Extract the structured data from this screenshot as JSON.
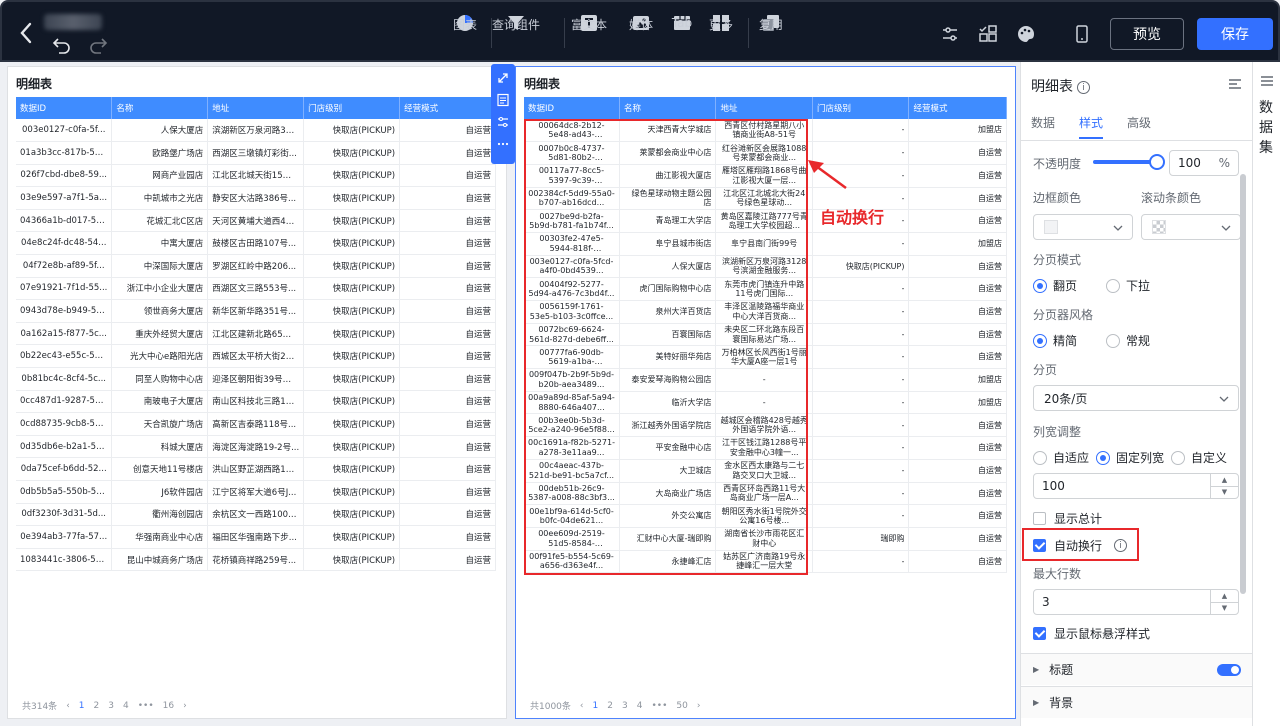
{
  "topbar": {
    "tools": [
      {
        "label": "图表",
        "icon": "pie-chart-icon"
      },
      {
        "label": "查询组件",
        "icon": "filter-icon"
      },
      {
        "label": "富文本",
        "icon": "rich-text-icon"
      },
      {
        "label": "媒体",
        "icon": "image-icon"
      },
      {
        "label": "Tab",
        "icon": "tab-icon"
      },
      {
        "label": "更多",
        "icon": "grid-icon"
      },
      {
        "label": "复用",
        "icon": "copy-icon"
      }
    ],
    "preview_label": "预览",
    "save_label": "保存"
  },
  "left_table": {
    "title": "明细表",
    "columns": [
      "数据ID",
      "名称",
      "地址",
      "门店级别",
      "经营模式"
    ],
    "rows": [
      [
        "003e0127-c0fa-5f...",
        "人保大厦店",
        "滨湖新区万泉河路31...",
        "快取店(PICKUP)",
        "自运营"
      ],
      [
        "01a3b3cc-817b-51...",
        "欧路堡广场店",
        "西湖区三墩镇灯彩街...",
        "快取店(PICKUP)",
        "自运营"
      ],
      [
        "026f7cbd-dbe8-59...",
        "网商产业园店",
        "江北区北城天街15号...",
        "快取店(PICKUP)",
        "自运营"
      ],
      [
        "03e9e597-a7f1-5a...",
        "中凯城市之光店",
        "静安区大沽路386号...",
        "快取店(PICKUP)",
        "自运营"
      ],
      [
        "04366a1b-d017-52...",
        "花城汇北C区店",
        "天河区黄埔大道西47...",
        "快取店(PICKUP)",
        "自运营"
      ],
      [
        "04e8c24f-dc48-54...",
        "中寓大厦店",
        "鼓楼区古田路107号...",
        "快取店(PICKUP)",
        "自运营"
      ],
      [
        "04f72e8b-af89-5f...",
        "中深国际大厦店",
        "罗湖区红岭中路206...",
        "快取店(PICKUP)",
        "自运营"
      ],
      [
        "07e91921-7f1d-55...",
        "浙江中小企业大厦店",
        "西湖区文三路553号...",
        "快取店(PICKUP)",
        "自运营"
      ],
      [
        "0943d78e-b949-5b...",
        "领世商务大厦店",
        "新华区新华路351号...",
        "快取店(PICKUP)",
        "自运营"
      ],
      [
        "0a162a15-f877-5c...",
        "重庆外经贸大厦店",
        "江北区建新北路65号...",
        "快取店(PICKUP)",
        "自运营"
      ],
      [
        "0b22ec43-e55c-5a...",
        "光大中心e路阳光店",
        "西城区太平桥大街25...",
        "快取店(PICKUP)",
        "自运营"
      ],
      [
        "0b81bc4c-8cf4-5c...",
        "同至人购物中心店",
        "迎泽区朝阳街39号同...",
        "快取店(PICKUP)",
        "自运营"
      ],
      [
        "0cc487d1-9287-53...",
        "南玻电子大厦店",
        "南山区科技北三路1号...",
        "快取店(PICKUP)",
        "自运营"
      ],
      [
        "0cd88735-9cb8-5d...",
        "天合凯旋广场店",
        "高新区吉泰路118号...",
        "快取店(PICKUP)",
        "自运营"
      ],
      [
        "0d35db6e-b2a1-55...",
        "科城大厦店",
        "海淀区海淀路19-2号...",
        "快取店(PICKUP)",
        "自运营"
      ],
      [
        "0da75cef-b6dd-52...",
        "创意天地11号楼店",
        "洪山区野芷湖西路16...",
        "快取店(PICKUP)",
        "自运营"
      ],
      [
        "0db5b5a5-550b-51...",
        "J6软件园店",
        "江宁区将军大道6号J...",
        "快取店(PICKUP)",
        "自运营"
      ],
      [
        "0df3230f-3d31-5d...",
        "衢州海创园店",
        "余杭区文一西路1001...",
        "快取店(PICKUP)",
        "自运营"
      ],
      [
        "0e394ab3-77fa-57...",
        "华强南商业中心店",
        "福田区华强南路下步...",
        "快取店(PICKUP)",
        "自运营"
      ],
      [
        "1083441c-3806-53...",
        "昆山中城商务广场店",
        "花桥镇商祥路259号...",
        "快取店(PICKUP)",
        "自运营"
      ]
    ],
    "pager": {
      "total": "共314条",
      "pages": [
        "1",
        "2",
        "3",
        "4",
        "•••",
        "16"
      ],
      "active": "1"
    }
  },
  "mid_table": {
    "title": "明细表",
    "columns": [
      "数据ID",
      "名称",
      "地址",
      "门店级别",
      "经营模式"
    ],
    "rows": [
      [
        "00064dc8-2b12-5e48-ad43-8de091e...",
        "天津西青大学城店",
        "西青区付村路星期八小镇商业街A8-51号",
        "-",
        "加盟店"
      ],
      [
        "0007b0c8-4737-5d81-80b2-93bc88d...",
        "莱蒙都会商业中心店",
        "红谷滩新区会展路1088号莱蒙都会商业...",
        "-",
        "自运营"
      ],
      [
        "00117a77-8cc5-5397-9c39-bbe724b...",
        "曲江影视大厦店",
        "雁塔区雁翔路1868号曲江影视大厦一层...",
        "-",
        "自运营"
      ],
      [
        "002384cf-5dd9-55a0-b707-ab16dcd...",
        "绿色星球动物主题公园店",
        "江北区江北城北大街24号绿色星球动...",
        "-",
        "自运营"
      ],
      [
        "0027be9d-b2fa-5b9d-b781-fa1b74f...",
        "青岛理工大学店",
        "黄岛区嘉陵江路777号青岛理工大学校园超...",
        "-",
        "自运营"
      ],
      [
        "00303fe2-47e5-5944-818f-418b281...",
        "阜宁县城市街店",
        "阜宁县南门街99号",
        "-",
        "加盟店"
      ],
      [
        "003e0127-c0fa-5fcd-a4f0-0bd4539...",
        "人保大厦店",
        "滨湖新区万泉河路3128号滨湖金融服务...",
        "快取店(PICKUP)",
        "自运营"
      ],
      [
        "00404f92-5277-5d94-a476-7c3bd4f...",
        "虎门国际购物中心店",
        "东莞市虎门镇连升中路11号虎门国际...",
        "-",
        "自运营"
      ],
      [
        "0056159f-1761-53e5-b103-3c0ffce...",
        "泉州大洋百货店",
        "丰泽区温陵路福华商业中心大洋百货商...",
        "-",
        "自运营"
      ],
      [
        "0072bc69-6624-561d-827d-debe6ff...",
        "百寰国际店",
        "未央区二环北路东段百寰国际易达广场...",
        "-",
        "自运营"
      ],
      [
        "00777fa6-90db-5619-a1ba-ed1085c...",
        "美特好丽华苑店",
        "万柏林区长风西街1号丽华大厦A座一层1号",
        "-",
        "自运营"
      ],
      [
        "009f047b-2b9f-5b9d-b20b-aea3489...",
        "泰安爱琴海购物公园店",
        "-",
        "-",
        "加盟店"
      ],
      [
        "00a9a89d-85af-5a94-8880-646a407...",
        "临沂大学店",
        "-",
        "-",
        "加盟店"
      ],
      [
        "00b3ee0b-5b3d-5ce2-a240-96e5f88...",
        "浙江越秀外国语学院店",
        "越城区会稽路428号越秀外国语学院外语...",
        "-",
        "自运营"
      ],
      [
        "00c1691a-f82b-5271-a278-3e11aa9...",
        "平安金融中心店",
        "江干区钱江路1288号平安金融中心3幢一...",
        "-",
        "自运营"
      ],
      [
        "00c4aeac-437b-521d-be91-bc5a7cf...",
        "大卫城店",
        "金水区西太康路与二七路交叉口大卫城...",
        "-",
        "自运营"
      ],
      [
        "00deb51b-26c9-5387-a008-88c3bf3...",
        "大岛商业广场店",
        "西青区环岛西路11号大岛商业广场一层A...",
        "-",
        "自运营"
      ],
      [
        "00e1bf9a-614d-5cf0-b0fc-04de621...",
        "外交公寓店",
        "朝阳区秀水街1号院外交公寓16号楼...",
        "-",
        "自运营"
      ],
      [
        "00ee609d-2519-51d5-8584-fb95dba...",
        "汇财中心大厦-瑞即购",
        "湖南省长沙市雨花区汇财中心",
        "瑞即购",
        "自运营"
      ],
      [
        "00f91fe5-b554-5c69-a656-d363e4f...",
        "永捷峰汇店",
        "姑苏区广济南路19号永捷峰汇一层大堂",
        "-",
        "自运营"
      ]
    ],
    "pager": {
      "total": "共1000条",
      "pages": [
        "1",
        "2",
        "3",
        "4",
        "•••",
        "50"
      ],
      "active": "1"
    }
  },
  "annotation": {
    "note": "自动换行",
    "color": "#e8282b"
  },
  "config": {
    "title": "明细表",
    "tabs": [
      "数据",
      "样式",
      "高级"
    ],
    "active_tab": "样式",
    "opacity": {
      "label": "不透明度",
      "value": "100",
      "unit": "%",
      "level": 1.0
    },
    "border_color_label": "边框颜色",
    "scroll_color_label": "滚动条颜色",
    "page_mode": {
      "label": "分页模式",
      "options": [
        "翻页",
        "下拉"
      ],
      "selected": "翻页"
    },
    "pager_style": {
      "label": "分页器风格",
      "options": [
        "精简",
        "常规"
      ],
      "selected": "精简"
    },
    "page_size": {
      "label": "分页",
      "value": "20条/页"
    },
    "col_width": {
      "label": "列宽调整",
      "options": [
        "自适应",
        "固定列宽",
        "自定义"
      ],
      "selected": "固定列宽",
      "value": "100"
    },
    "show_total": {
      "label": "显示总计",
      "checked": false
    },
    "auto_wrap": {
      "label": "自动换行",
      "checked": true
    },
    "max_rows": {
      "label": "最大行数",
      "value": "3"
    },
    "hover_style": {
      "label": "显示鼠标悬浮样式",
      "checked": true
    },
    "sections": [
      "标题",
      "背景"
    ]
  },
  "dataset_side": {
    "label": "数据集"
  },
  "colors": {
    "accent": "#3370ff",
    "header_bg": "#3f8cff",
    "topbar_bg": "#111826"
  }
}
